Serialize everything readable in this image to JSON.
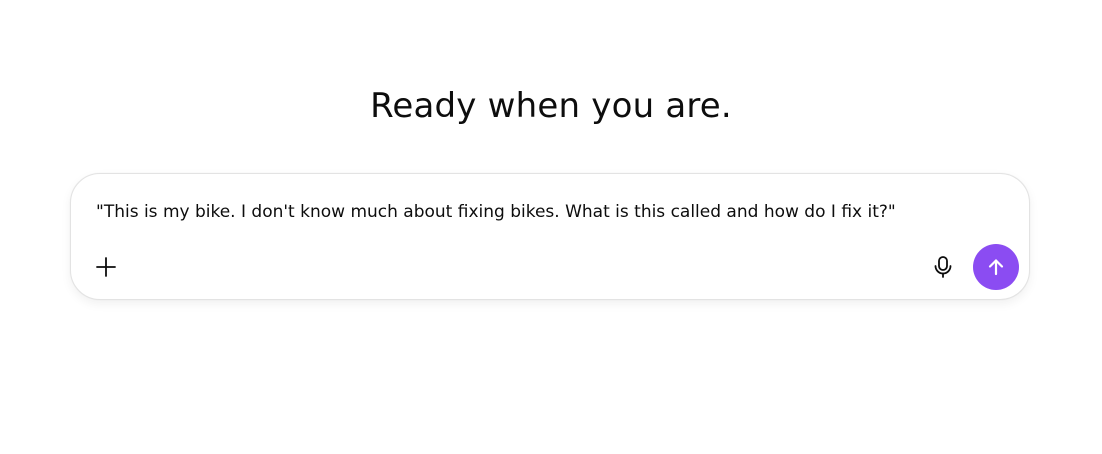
{
  "headline": "Ready when you are.",
  "composer": {
    "prompt_value": "\"This is my bike. I don't know much about fixing bikes. What is this called and how do I fix it?\"",
    "icons": {
      "add": "plus-icon",
      "voice": "microphone-icon",
      "send": "arrow-up-icon"
    },
    "colors": {
      "send_button": "#8b4cf2",
      "border": "#e3e3e3"
    }
  }
}
